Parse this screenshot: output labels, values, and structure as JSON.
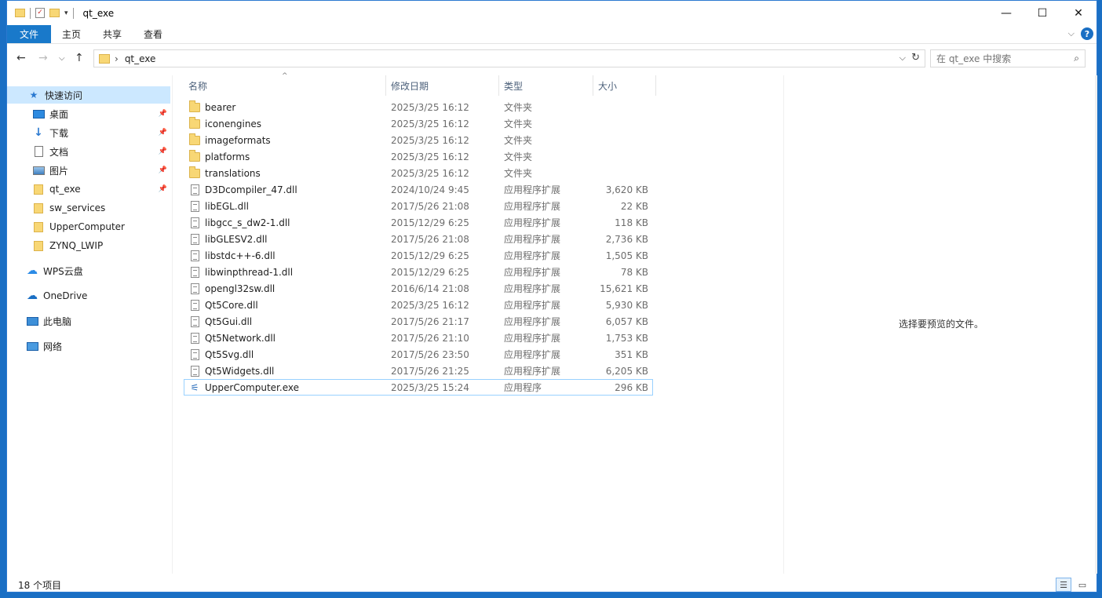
{
  "window": {
    "title": "qt_exe",
    "controls": {
      "minimize": "—",
      "maximize": "☐",
      "close": "✕"
    }
  },
  "ribbon": {
    "tabs": [
      "文件",
      "主页",
      "共享",
      "查看"
    ],
    "expand_icon": "chevron-down-icon",
    "help": "?"
  },
  "address": {
    "path": "qt_exe",
    "search_placeholder": "在 qt_exe 中搜索"
  },
  "nav": {
    "quick_access": "快速访问",
    "pinned": [
      {
        "label": "桌面",
        "icon": "desktop-icon"
      },
      {
        "label": "下载",
        "icon": "download-icon"
      },
      {
        "label": "文档",
        "icon": "documents-icon"
      },
      {
        "label": "图片",
        "icon": "pictures-icon"
      },
      {
        "label": "qt_exe",
        "icon": "folder-icon"
      }
    ],
    "folders": [
      "sw_services",
      "UpperComputer",
      "ZYNQ_LWIP"
    ],
    "wps": "WPS云盘",
    "onedrive": "OneDrive",
    "thispc": "此电脑",
    "network": "网络"
  },
  "columns": {
    "name": "名称",
    "date": "修改日期",
    "type": "类型",
    "size": "大小"
  },
  "files": [
    {
      "name": "bearer",
      "date": "2025/3/25 16:12",
      "type": "文件夹",
      "size": "",
      "kind": "folder"
    },
    {
      "name": "iconengines",
      "date": "2025/3/25 16:12",
      "type": "文件夹",
      "size": "",
      "kind": "folder"
    },
    {
      "name": "imageformats",
      "date": "2025/3/25 16:12",
      "type": "文件夹",
      "size": "",
      "kind": "folder"
    },
    {
      "name": "platforms",
      "date": "2025/3/25 16:12",
      "type": "文件夹",
      "size": "",
      "kind": "folder"
    },
    {
      "name": "translations",
      "date": "2025/3/25 16:12",
      "type": "文件夹",
      "size": "",
      "kind": "folder"
    },
    {
      "name": "D3Dcompiler_47.dll",
      "date": "2024/10/24 9:45",
      "type": "应用程序扩展",
      "size": "3,620 KB",
      "kind": "dll"
    },
    {
      "name": "libEGL.dll",
      "date": "2017/5/26 21:08",
      "type": "应用程序扩展",
      "size": "22 KB",
      "kind": "dll"
    },
    {
      "name": "libgcc_s_dw2-1.dll",
      "date": "2015/12/29 6:25",
      "type": "应用程序扩展",
      "size": "118 KB",
      "kind": "dll"
    },
    {
      "name": "libGLESV2.dll",
      "date": "2017/5/26 21:08",
      "type": "应用程序扩展",
      "size": "2,736 KB",
      "kind": "dll"
    },
    {
      "name": "libstdc++-6.dll",
      "date": "2015/12/29 6:25",
      "type": "应用程序扩展",
      "size": "1,505 KB",
      "kind": "dll"
    },
    {
      "name": "libwinpthread-1.dll",
      "date": "2015/12/29 6:25",
      "type": "应用程序扩展",
      "size": "78 KB",
      "kind": "dll"
    },
    {
      "name": "opengl32sw.dll",
      "date": "2016/6/14 21:08",
      "type": "应用程序扩展",
      "size": "15,621 KB",
      "kind": "dll"
    },
    {
      "name": "Qt5Core.dll",
      "date": "2025/3/25 16:12",
      "type": "应用程序扩展",
      "size": "5,930 KB",
      "kind": "dll"
    },
    {
      "name": "Qt5Gui.dll",
      "date": "2017/5/26 21:17",
      "type": "应用程序扩展",
      "size": "6,057 KB",
      "kind": "dll"
    },
    {
      "name": "Qt5Network.dll",
      "date": "2017/5/26 21:10",
      "type": "应用程序扩展",
      "size": "1,753 KB",
      "kind": "dll"
    },
    {
      "name": "Qt5Svg.dll",
      "date": "2017/5/26 23:50",
      "type": "应用程序扩展",
      "size": "351 KB",
      "kind": "dll"
    },
    {
      "name": "Qt5Widgets.dll",
      "date": "2017/5/26 21:25",
      "type": "应用程序扩展",
      "size": "6,205 KB",
      "kind": "dll"
    },
    {
      "name": "UpperComputer.exe",
      "date": "2025/3/25 15:24",
      "type": "应用程序",
      "size": "296 KB",
      "kind": "exe"
    }
  ],
  "preview": {
    "message": "选择要预览的文件。"
  },
  "status": {
    "count": "18 个项目"
  },
  "colors": {
    "accent": "#1979ca",
    "selection": "#cce8ff",
    "focus_border": "#99d1ff"
  }
}
